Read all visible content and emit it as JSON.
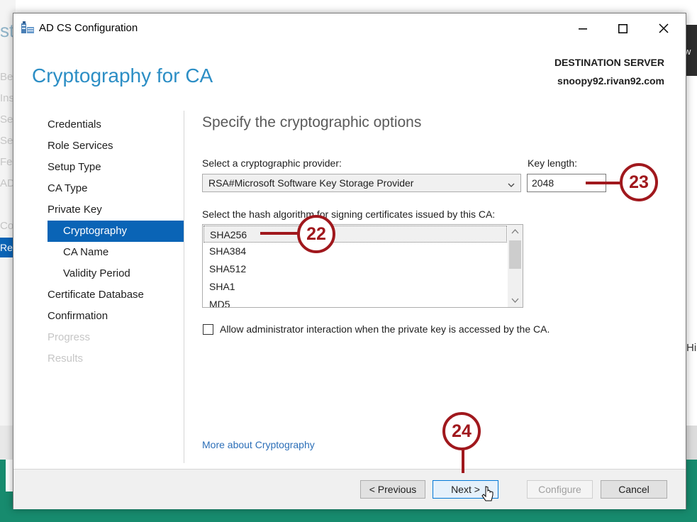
{
  "background": {
    "left_snippets": [
      "st",
      "Be",
      "Ins",
      "Se",
      "Se",
      "Fe",
      "AD",
      "Co",
      "Re"
    ],
    "right_snippet_top": "w",
    "right_snippet_mid": "Hi"
  },
  "window": {
    "title": "AD CS Configuration",
    "minimize_icon": "minimize-icon",
    "maximize_icon": "maximize-icon",
    "close_icon": "close-icon"
  },
  "header": {
    "page_title": "Cryptography for CA",
    "destination_label": "DESTINATION SERVER",
    "destination_server": "snoopy92.rivan92.com"
  },
  "nav": {
    "items": [
      {
        "label": "Credentials",
        "state": "normal",
        "sub": false
      },
      {
        "label": "Role Services",
        "state": "normal",
        "sub": false
      },
      {
        "label": "Setup Type",
        "state": "normal",
        "sub": false
      },
      {
        "label": "CA Type",
        "state": "normal",
        "sub": false
      },
      {
        "label": "Private Key",
        "state": "normal",
        "sub": false
      },
      {
        "label": "Cryptography",
        "state": "active",
        "sub": true
      },
      {
        "label": "CA Name",
        "state": "normal",
        "sub": true
      },
      {
        "label": "Validity Period",
        "state": "normal",
        "sub": true
      },
      {
        "label": "Certificate Database",
        "state": "normal",
        "sub": false
      },
      {
        "label": "Confirmation",
        "state": "normal",
        "sub": false
      },
      {
        "label": "Progress",
        "state": "disabled",
        "sub": false
      },
      {
        "label": "Results",
        "state": "disabled",
        "sub": false
      }
    ]
  },
  "main": {
    "section_title": "Specify the cryptographic options",
    "provider_label": "Select a cryptographic provider:",
    "provider_value": "RSA#Microsoft Software Key Storage Provider",
    "key_length_label": "Key length:",
    "key_length_value": "2048",
    "hash_label": "Select the hash algorithm for signing certificates issued by this CA:",
    "hash_options": [
      "SHA256",
      "SHA384",
      "SHA512",
      "SHA1",
      "MD5"
    ],
    "hash_selected": "SHA256",
    "allow_admin_label": "Allow administrator interaction when the private key is accessed by the CA.",
    "allow_admin_checked": false,
    "more_link": "More about Cryptography"
  },
  "footer": {
    "previous": "< Previous",
    "next": "Next >",
    "configure": "Configure",
    "cancel": "Cancel"
  },
  "callouts": {
    "c22": "22",
    "c23": "23",
    "c24": "24"
  },
  "colors": {
    "accent": "#0a64b6",
    "title_blue": "#2c8ec5",
    "callout_red": "#a0181d",
    "background_green": "#178b6e"
  }
}
